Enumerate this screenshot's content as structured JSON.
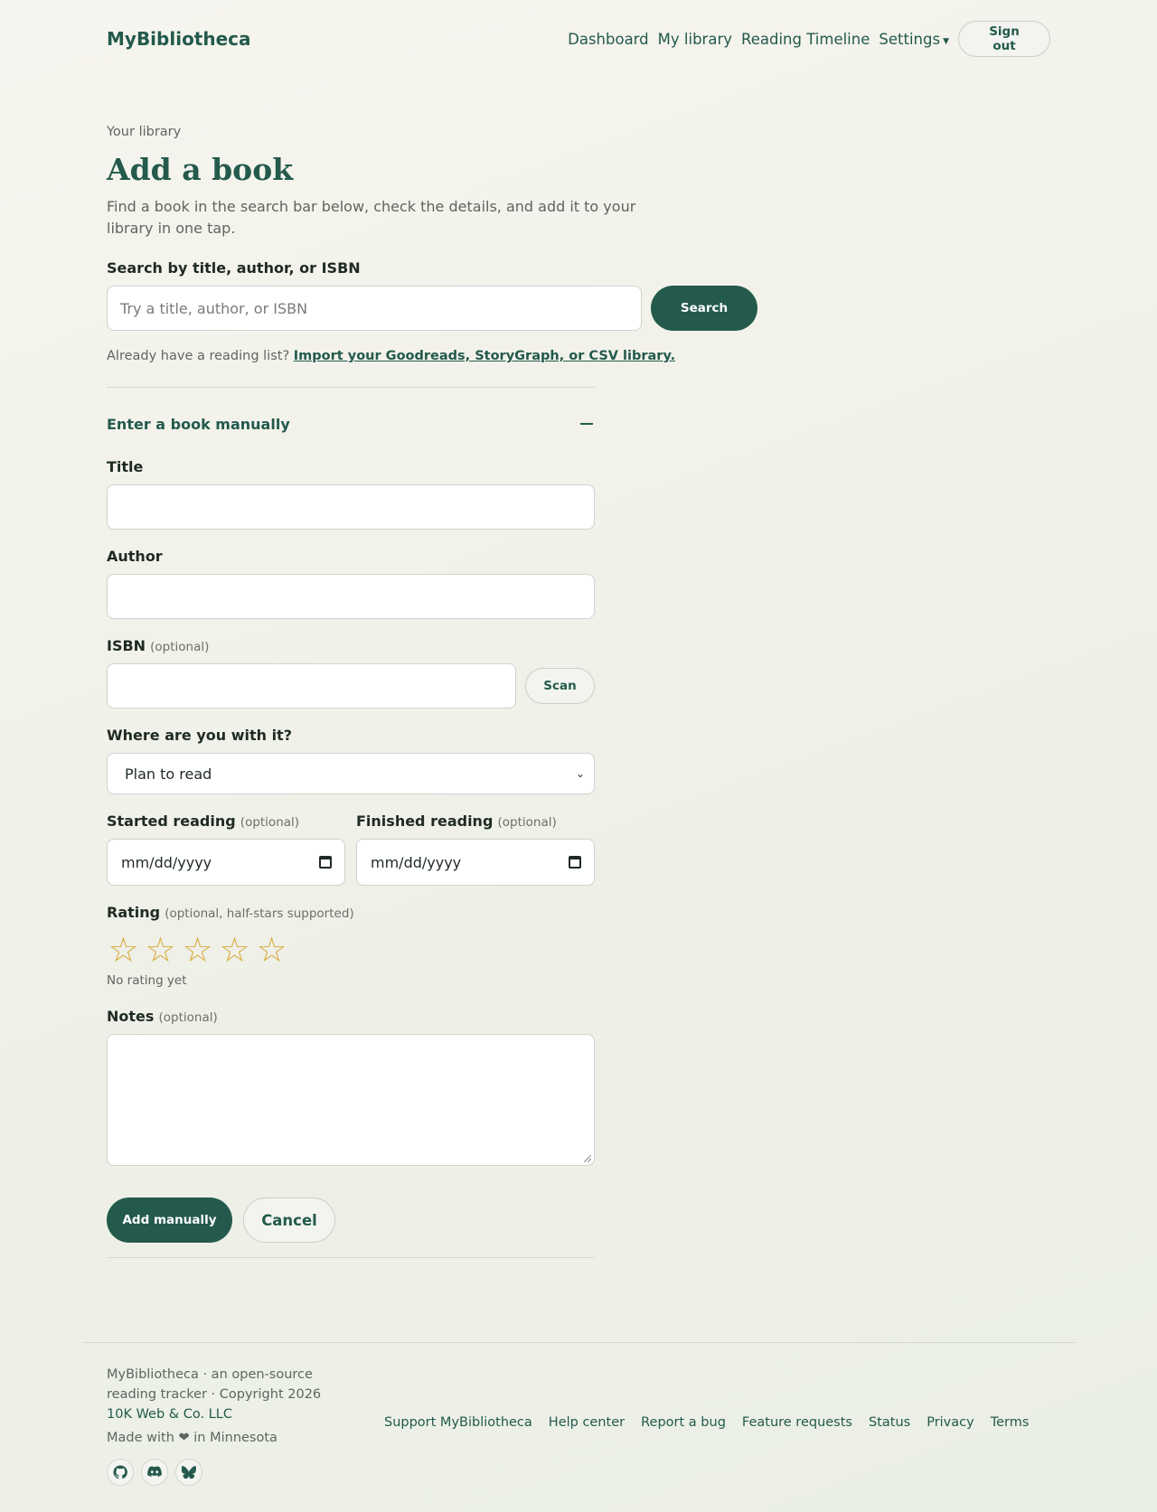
{
  "header": {
    "brand": "MyBibliotheca",
    "nav": [
      "Dashboard",
      "My library",
      "Reading Timeline",
      "Settings"
    ],
    "sign_out": "Sign out"
  },
  "main": {
    "eyebrow": "Your library",
    "title": "Add a book",
    "lead": "Find a book in the search bar below, check the details, and add it to your library in one tap.",
    "search": {
      "label": "Search by title, author, or ISBN",
      "placeholder": "Try a title, author, or ISBN",
      "button": "Search"
    },
    "import": {
      "prefix": "Already have a reading list?",
      "link": "Import your Goodreads, StoryGraph, or CSV library."
    },
    "manual": {
      "heading": "Enter a book manually",
      "title_label": "Title",
      "author_label": "Author",
      "isbn_label": "ISBN",
      "isbn_optional": "(optional)",
      "scan_button": "Scan",
      "status_label": "Where are you with it?",
      "status_value": "Plan to read",
      "started_label": "Started reading",
      "started_optional": "(optional)",
      "finished_label": "Finished reading",
      "finished_optional": "(optional)",
      "date_placeholder": "mm/dd/yyyy",
      "rating_label": "Rating",
      "rating_optional": "(optional, half-stars supported)",
      "rating_value": 0,
      "rating_max": 5,
      "rating_status": "No rating yet",
      "notes_label": "Notes",
      "notes_optional": "(optional)",
      "add_button": "Add manually",
      "cancel_button": "Cancel"
    }
  },
  "footer": {
    "line1": "MyBibliotheca · an open-source",
    "line2": "reading tracker · Copyright 2026",
    "company": "10K Web & Co. LLC",
    "made": "Made with ❤ in Minnesota",
    "links": [
      "Support MyBibliotheca",
      "Help center",
      "Report a bug",
      "Feature requests",
      "Status",
      "Privacy",
      "Terms"
    ],
    "socials": [
      "github-icon",
      "discord-icon",
      "bluesky-icon"
    ]
  },
  "colors": {
    "accent": "#235a4c",
    "star": "#d9aa3c"
  }
}
